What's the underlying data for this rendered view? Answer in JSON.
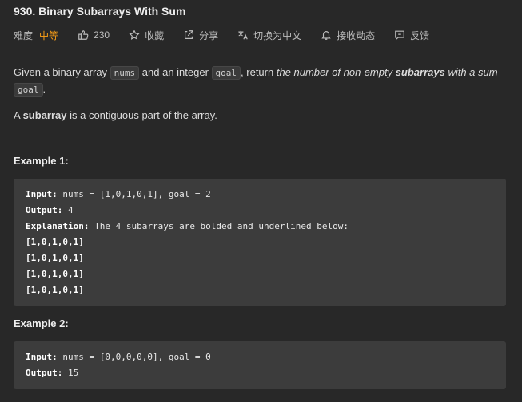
{
  "problem": {
    "title": "930. Binary Subarrays With Sum"
  },
  "meta": {
    "difficulty_label": "难度",
    "difficulty_value": "中等",
    "likes": "230",
    "favorite": "收藏",
    "share": "分享",
    "switch_lang": "切换为中文",
    "notify": "接收动态",
    "feedback": "反馈",
    "colors": {
      "difficulty": "#ffa116"
    }
  },
  "description": {
    "p1_a": "Given a binary array ",
    "p1_code1": "nums",
    "p1_b": " and an integer ",
    "p1_code2": "goal",
    "p1_c": ", return ",
    "p1_em1": "the number of non-empty ",
    "p1_strong": "subarrays",
    "p1_em2": " with a sum ",
    "p1_code3": "goal",
    "p1_d": ".",
    "p2_a": "A ",
    "p2_strong": "subarray",
    "p2_b": " is a contiguous part of the array."
  },
  "example1": {
    "heading": "Example 1:",
    "input_label": "Input:",
    "input_value": " nums = [1,0,1,0,1], goal = 2",
    "output_label": "Output:",
    "output_value": " 4",
    "explanation_label": "Explanation:",
    "explanation_value": " The 4 subarrays are bolded and underlined below:",
    "arrays": [
      [
        "[",
        "1,0,1",
        ",0,1]"
      ],
      [
        "[",
        "1,0,1,0",
        ",1]"
      ],
      [
        "[1,",
        "0,1,0,1",
        "]"
      ],
      [
        "[1,0,",
        "1,0,1",
        "]"
      ]
    ]
  },
  "example2": {
    "heading": "Example 2:",
    "input_label": "Input:",
    "input_value": " nums = [0,0,0,0,0], goal = 0",
    "output_label": "Output:",
    "output_value": " 15"
  }
}
